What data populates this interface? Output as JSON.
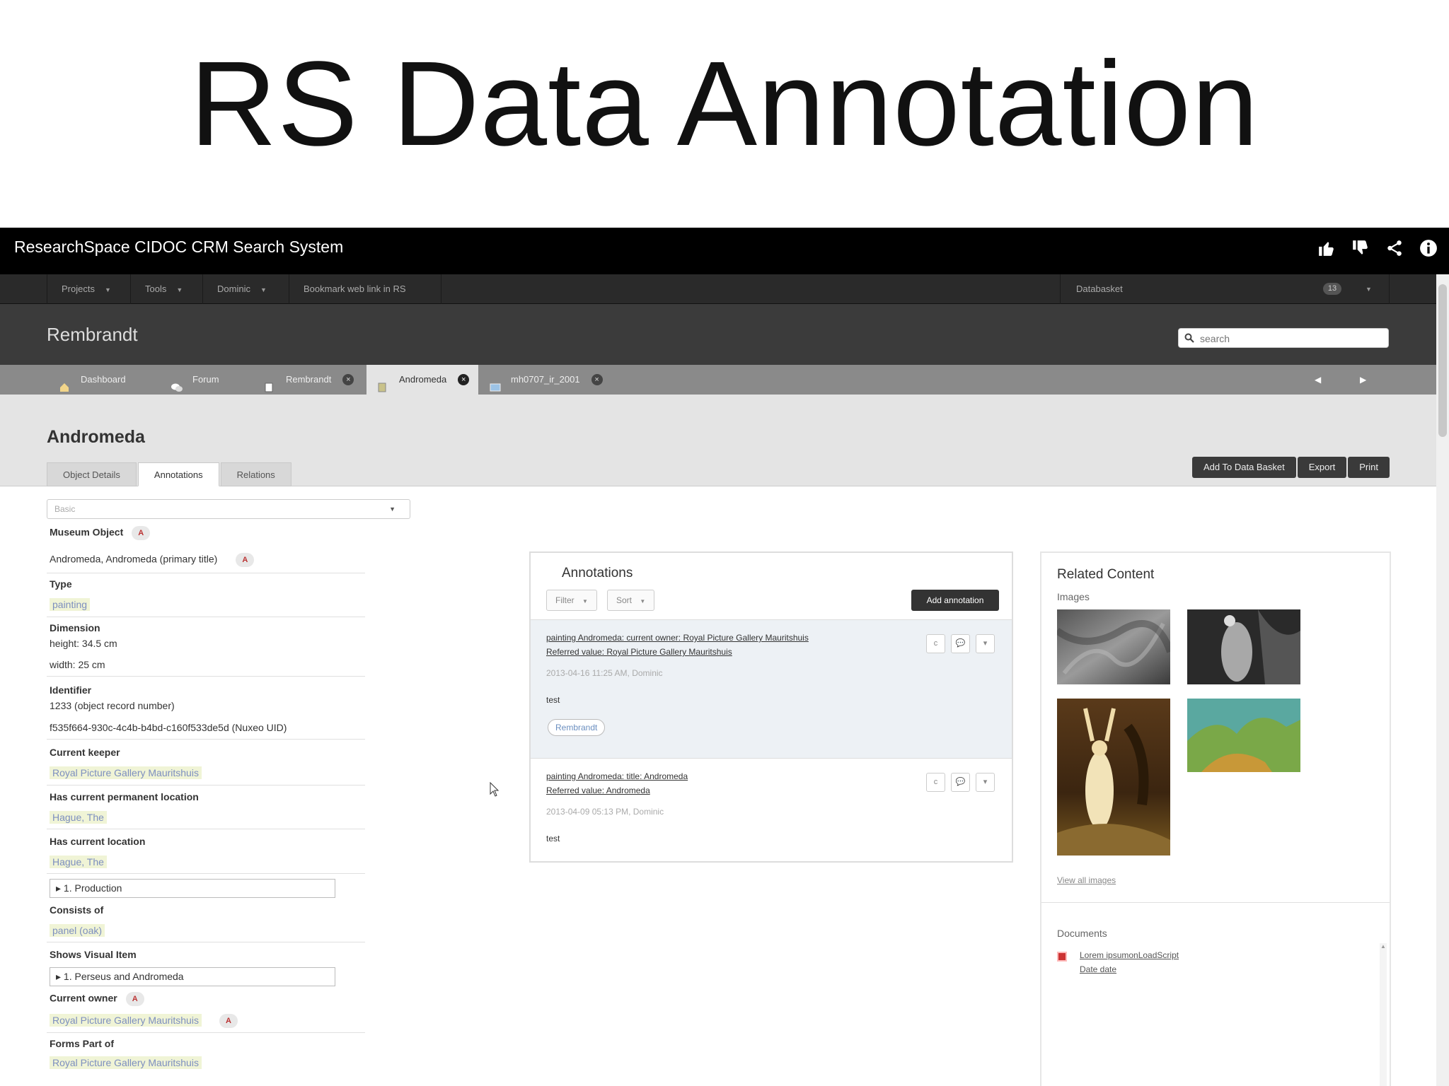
{
  "slide_title": "RS Data Annotation",
  "app": {
    "name": "ResearchSpace CIDOC CRM Search System",
    "top_icons": [
      "thumbs-up-icon",
      "thumbs-down-icon",
      "share-icon",
      "info-icon"
    ]
  },
  "nav": {
    "items": [
      "Projects",
      "Tools",
      "Dominic",
      "Bookmark web link in RS"
    ],
    "databasket_label": "Databasket",
    "databasket_count": "13"
  },
  "project": {
    "title": "Rembrandt",
    "search_placeholder": "search"
  },
  "tabs": [
    {
      "label": "Dashboard",
      "icon": "home-icon"
    },
    {
      "label": "Forum",
      "icon": "chat-icon"
    },
    {
      "label": "Rembrandt",
      "icon": "document-icon"
    },
    {
      "label": "Andromeda",
      "icon": "object-icon",
      "active": true
    },
    {
      "label": "mh0707_ir_2001",
      "icon": "image-icon"
    }
  ],
  "object": {
    "title": "Andromeda",
    "subtabs": [
      "Object Details",
      "Annotations",
      "Relations"
    ],
    "active_subtab": "Annotations",
    "actions": [
      "Add To Data Basket",
      "Export",
      "Print"
    ]
  },
  "properties": {
    "view_select": "Basic",
    "museum_object_label": "Museum Object",
    "title_value": "Andromeda, Andromeda (primary title)",
    "type_label": "Type",
    "type_value": "painting",
    "dimension_label": "Dimension",
    "height_value": "height: 34.5 cm",
    "width_value": "width: 25 cm",
    "identifier_label": "Identifier",
    "identifier_1": "1233 (object record number)",
    "identifier_2": "f535f664-930c-4c4b-b4bd-c160f533de5d (Nuxeo UID)",
    "keeper_label": "Current keeper",
    "keeper_value": "Royal Picture Gallery Mauritshuis",
    "perm_location_label": "Has current permanent location",
    "perm_location_value": "Hague, The",
    "location_label": "Has current location",
    "location_value": "Hague, The",
    "production_box": "1. Production",
    "consists_label": "Consists of",
    "consists_value": "panel (oak)",
    "shows_label": "Shows Visual Item",
    "shows_box": "1. Perseus and Andromeda",
    "owner_label": "Current owner",
    "owner_value": "Royal Picture Gallery Mauritshuis",
    "forms_part_label": "Forms Part of",
    "forms_part_value": "Royal Picture Gallery Mauritshuis",
    "annotation_badge": "A"
  },
  "annotations": {
    "title": "Annotations",
    "filter_label": "Filter",
    "sort_label": "Sort",
    "add_label": "Add annotation",
    "items": [
      {
        "link": "painting Andromeda: current owner: Royal Picture Gallery Mauritshuis",
        "referred": "Referred value: Royal Picture Gallery Mauritshuis",
        "meta": "2013-04-16 11:25 AM, Dominic",
        "body": "test",
        "tag": "Rembrandt"
      },
      {
        "link": "painting Andromeda: title: Andromeda",
        "referred": "Referred value: Andromeda",
        "meta": "2013-04-09 05:13 PM, Dominic",
        "body": "test"
      }
    ],
    "btn_c": "c"
  },
  "related": {
    "title": "Related Content",
    "images_label": "Images",
    "view_all": "View all images",
    "documents_label": "Documents",
    "doc_link": "Lorem ipsumonLoadScript",
    "doc_date": "Date date"
  },
  "colors": {
    "topbar": "#000000",
    "navbar": "#2a2a2a",
    "project_bar": "#3b3b3b",
    "tabbar": "#8a8a8a",
    "link_highlight": "#f0f4d6",
    "link_text": "#7d8fbf"
  }
}
